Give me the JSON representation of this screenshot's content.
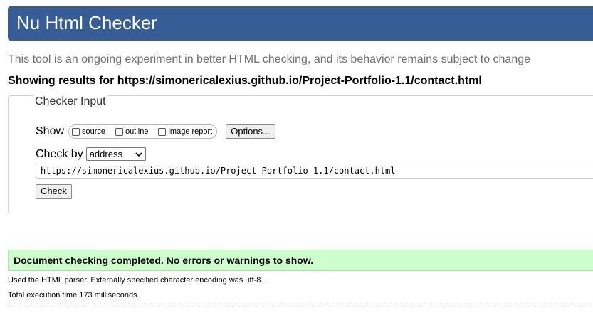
{
  "header": {
    "title": "Nu Html Checker"
  },
  "subtitle": "This tool is an ongoing experiment in better HTML checking, and its behavior remains subject to change",
  "showing": "Showing results for https://simonericalexius.github.io/Project-Portfolio-1.1/contact.html",
  "checker": {
    "legend": "Checker Input",
    "show_label": "Show",
    "options": [
      {
        "label": "source",
        "checked": false
      },
      {
        "label": "outline",
        "checked": false
      },
      {
        "label": "image report",
        "checked": false
      }
    ],
    "options_button": "Options...",
    "check_by_label": "Check by",
    "check_by_value": "address",
    "url_value": "https://simonericalexius.github.io/Project-Portfolio-1.1/contact.html",
    "check_button": "Check"
  },
  "result": {
    "message": "Document checking completed. No errors or warnings to show.",
    "parser_info": "Used the HTML parser. Externally specified character encoding was utf-8.",
    "execution_time": "Total execution time 173 milliseconds."
  },
  "colors": {
    "header_bg": "#365d95",
    "success_bg": "#ccffcc"
  }
}
